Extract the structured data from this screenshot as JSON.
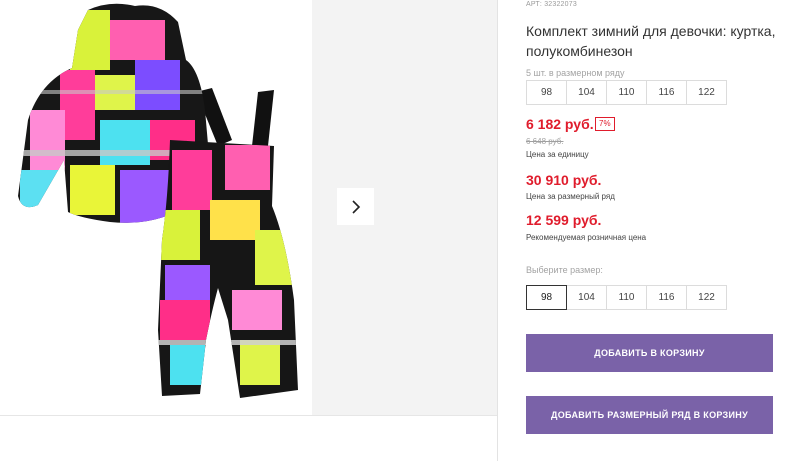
{
  "product": {
    "article": "АРТ: 32322073",
    "title": "Комплект зимний для девочки: куртка, полукомбинезон"
  },
  "series": {
    "caption": "5 шт. в размерном ряду",
    "sizes": [
      "98",
      "104",
      "110",
      "116",
      "122"
    ]
  },
  "pricing": {
    "unit_price": "6 182 руб.",
    "discount_badge": "7%",
    "old_price": "6 648 руб.",
    "unit_price_caption": "Цена за единицу",
    "series_price": "30 910 руб.",
    "series_price_caption": "Цена за размерный ряд",
    "retail_price": "12 599 руб.",
    "retail_price_caption": "Рекомендуемая розничная цена"
  },
  "size_picker": {
    "label": "Выберите размер:",
    "sizes": [
      "98",
      "104",
      "110",
      "116",
      "122"
    ],
    "selected": "98"
  },
  "buttons": {
    "add_to_cart": "ДОБАВИТЬ В КОРЗИНУ",
    "add_series_to_cart": "ДОБАВИТЬ РАЗМЕРНЫЙ РЯД В КОРЗИНУ"
  },
  "gallery": {
    "next_icon": "chevron-right-icon",
    "image_alt": "product-photo"
  },
  "colors": {
    "price_red": "#e01c2c",
    "button_purple": "#7a62a8"
  }
}
